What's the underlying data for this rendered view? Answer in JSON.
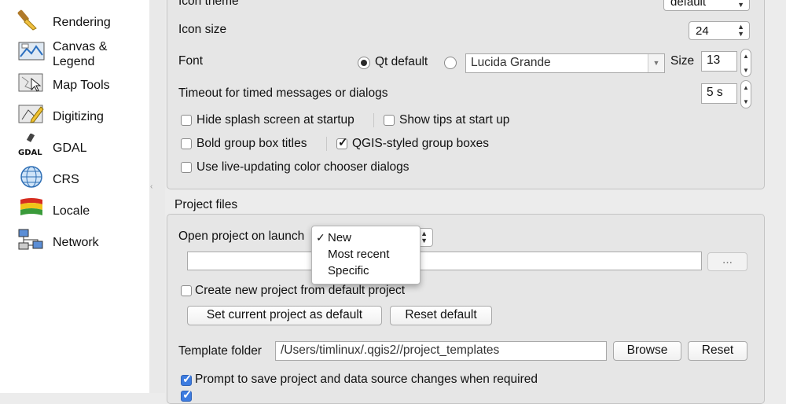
{
  "sidebar": {
    "items": [
      {
        "label": "Rendering",
        "icon": "paintbrush-icon"
      },
      {
        "label": "Canvas &",
        "label2": "Legend",
        "icon": "canvas-legend-icon"
      },
      {
        "label": "Map Tools",
        "icon": "map-tools-icon"
      },
      {
        "label": "Digitizing",
        "icon": "digitizing-icon"
      },
      {
        "label": "GDAL",
        "icon": "gdal-icon"
      },
      {
        "label": "CRS",
        "icon": "globe-icon"
      },
      {
        "label": "Locale",
        "icon": "flag-icon"
      },
      {
        "label": "Network",
        "icon": "network-icon"
      }
    ]
  },
  "app_group": {
    "icon_theme_label": "Icon theme",
    "icon_theme_value": "default",
    "icon_size_label": "Icon size",
    "icon_size_value": "24",
    "font_label": "Font",
    "font_qt_default": "Qt default",
    "font_custom_value": "Lucida Grande",
    "font_size_label": "Size",
    "font_size_value": "13",
    "timeout_label": "Timeout for timed messages or dialogs",
    "timeout_value": "5 s",
    "hide_splash": "Hide splash screen at startup",
    "show_tips": "Show tips at start up",
    "bold_group_titles": "Bold group box titles",
    "qgis_styled_groups": "QGIS-styled group boxes",
    "live_color_chooser": "Use live-updating color chooser dialogs"
  },
  "project_files": {
    "title": "Project files",
    "open_on_launch_label": "Open project on launch",
    "launch_options": [
      "New",
      "Most recent",
      "Specific"
    ],
    "selected_option": "New",
    "browse_dots": "...",
    "create_from_default": "Create new project from default project",
    "set_current_default": "Set current project as default",
    "reset_default": "Reset default",
    "template_folder_label": "Template folder",
    "template_folder_value": "/Users/timlinux/.qgis2//project_templates",
    "browse": "Browse",
    "reset": "Reset",
    "prompt_save": "Prompt to save project and data source changes when required"
  },
  "colors": {
    "accent": "#3d7ce0",
    "sidebar_bg": "#ffffff",
    "panel_bg": "#ececec"
  }
}
